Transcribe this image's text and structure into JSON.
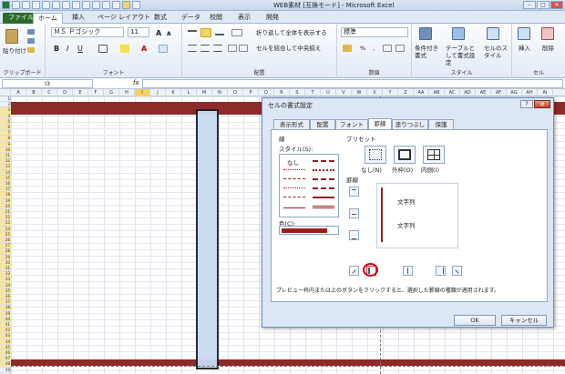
{
  "window": {
    "title": "WEB素材 [互換モード] - Microsoft Excel",
    "min": "–",
    "max": "□",
    "close": "✕"
  },
  "ribbon_tabs": [
    "ファイル",
    "ホーム",
    "挿入",
    "ページ レイアウト",
    "数式",
    "データ",
    "校閲",
    "表示",
    "開発"
  ],
  "ribbon": {
    "clipboard": {
      "paste": "貼り付け",
      "label": "クリップボード"
    },
    "font": {
      "name": "ＭＳ Ｐゴシック",
      "size": "11",
      "label": "フォント",
      "grow": "A",
      "shrink": "A",
      "bold": "B",
      "italic": "I",
      "underline": "U",
      "color_a": "A"
    },
    "alignment": {
      "wrap": "折り返して全体を表示する",
      "merge": "セルを結合して中央揃え",
      "label": "配置"
    },
    "number": {
      "format": "標準",
      "percent": "%",
      "comma": ",",
      "label": "数値"
    },
    "styles": {
      "cond": "条件付き書式",
      "table": "テーブルとして書式設定",
      "cell": "セルのスタイル",
      "label": "スタイル"
    },
    "cells": {
      "insert": "挿入",
      "delete": "削除",
      "label": "セル"
    }
  },
  "formula_bar": {
    "name_box": "I3",
    "fx": "fx"
  },
  "columns": [
    "A",
    "B",
    "C",
    "D",
    "E",
    "F",
    "G",
    "H",
    "I",
    "J",
    "K",
    "L",
    "M",
    "N",
    "O",
    "P",
    "Q",
    "R",
    "S",
    "T",
    "U",
    "V",
    "W",
    "X",
    "Y",
    "Z",
    "AA",
    "AB",
    "AC",
    "AD",
    "AE",
    "AF",
    "AG",
    "AH",
    "AI"
  ],
  "rows": [
    "1",
    "2",
    "3",
    "4",
    "5",
    "6",
    "7",
    "8",
    "9",
    "10",
    "11",
    "12",
    "13",
    "14",
    "15",
    "16",
    "17",
    "18",
    "19",
    "20",
    "21",
    "22",
    "23",
    "24",
    "25",
    "26",
    "27",
    "28",
    "29",
    "30",
    "31",
    "32",
    "33",
    "34",
    "35",
    "36",
    "37",
    "38",
    "39",
    "40",
    "41",
    "42",
    "43",
    "44",
    "45",
    "46",
    "47",
    "48",
    "49"
  ],
  "dialog": {
    "title": "セルの書式設定",
    "help": "?",
    "close": "✕",
    "tabs": [
      "表示形式",
      "配置",
      "フォント",
      "罫線",
      "塗りつぶし",
      "保護"
    ],
    "active_tab": "罫線",
    "line_section": "線",
    "style_label": "スタイル(S):",
    "none": "なし",
    "color_label": "色(C):",
    "line_color": "#9b1c1c",
    "preset_label": "プリセット",
    "presets": [
      "なし(N)",
      "外枠(O)",
      "内側(I)"
    ],
    "border_label": "罫線",
    "preview_text": [
      "文字列",
      "文字列"
    ],
    "note": "プレビュー枠内または上のボタンをクリックすると、選択した罫線の種類が適用されます。",
    "ok": "OK",
    "cancel": "キャンセル"
  }
}
